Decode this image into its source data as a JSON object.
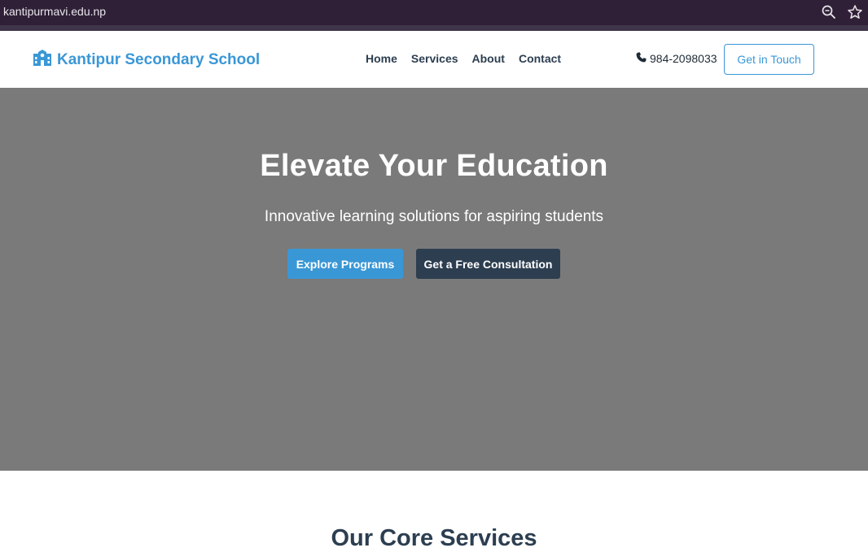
{
  "browser": {
    "url": "kantipurmavi.edu.np",
    "icons": [
      "zoom-icon",
      "star-icon"
    ]
  },
  "header": {
    "logo_icon": "school-icon",
    "site_name": "Kantipur Secondary School",
    "nav": [
      {
        "label": "Home"
      },
      {
        "label": "Services"
      },
      {
        "label": "About"
      },
      {
        "label": "Contact"
      }
    ],
    "phone_icon": "phone-icon",
    "phone": "984-2098033",
    "cta_label": "Get in Touch"
  },
  "hero": {
    "title": "Elevate Your Education",
    "subtitle": "Innovative learning solutions for aspiring students",
    "primary_button": "Explore Programs",
    "secondary_button": "Get a Free Consultation"
  },
  "services": {
    "heading": "Our Core Services"
  },
  "colors": {
    "brand": "#3a97d6",
    "dark": "#2c3e50",
    "hero_bg": "#7a7a7a",
    "browser_bar": "#2f2038"
  }
}
